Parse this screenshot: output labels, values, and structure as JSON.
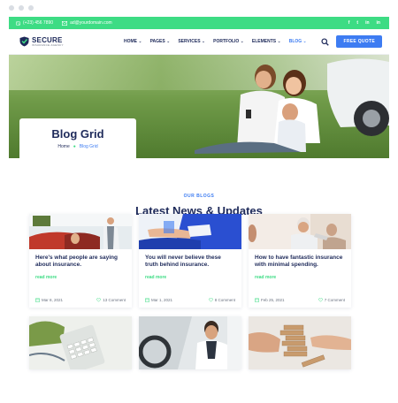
{
  "topbar": {
    "phone": "(+23) 456 7890",
    "email": "ad@yourdomain.com",
    "social": [
      "f",
      "t",
      "in",
      "in"
    ]
  },
  "brand": {
    "name": "SECURE",
    "tagline": "INSURANCE AGENCY"
  },
  "nav": {
    "items": [
      "HOME",
      "PAGES",
      "SERVICES",
      "PORTFOLIO",
      "ELEMENTS",
      "BLOG"
    ],
    "cta": "FREE QUOTE"
  },
  "hero": {
    "title": "Blog Grid",
    "breadcrumb": [
      "Home",
      "Blog Grid"
    ]
  },
  "section": {
    "eyebrow": "OUR BLOGS",
    "title": "Latest News & Updates"
  },
  "posts": [
    {
      "title": "Here's what people are saying about insurance.",
      "read_more": "read more",
      "date": "Mar 8, 2021",
      "comments": "13 Comment"
    },
    {
      "title": "You will never believe these truth behind insurance.",
      "read_more": "read more",
      "date": "Mar 1, 2021",
      "comments": "8 Comment"
    },
    {
      "title": "How to have fantastic insurance with minimal spending.",
      "read_more": "read more",
      "date": "Feb 25, 2021",
      "comments": "7 Comment"
    }
  ],
  "colors": {
    "accent": "#3ddc84",
    "primary": "#3d7cf2",
    "navy": "#1e2a5a"
  }
}
